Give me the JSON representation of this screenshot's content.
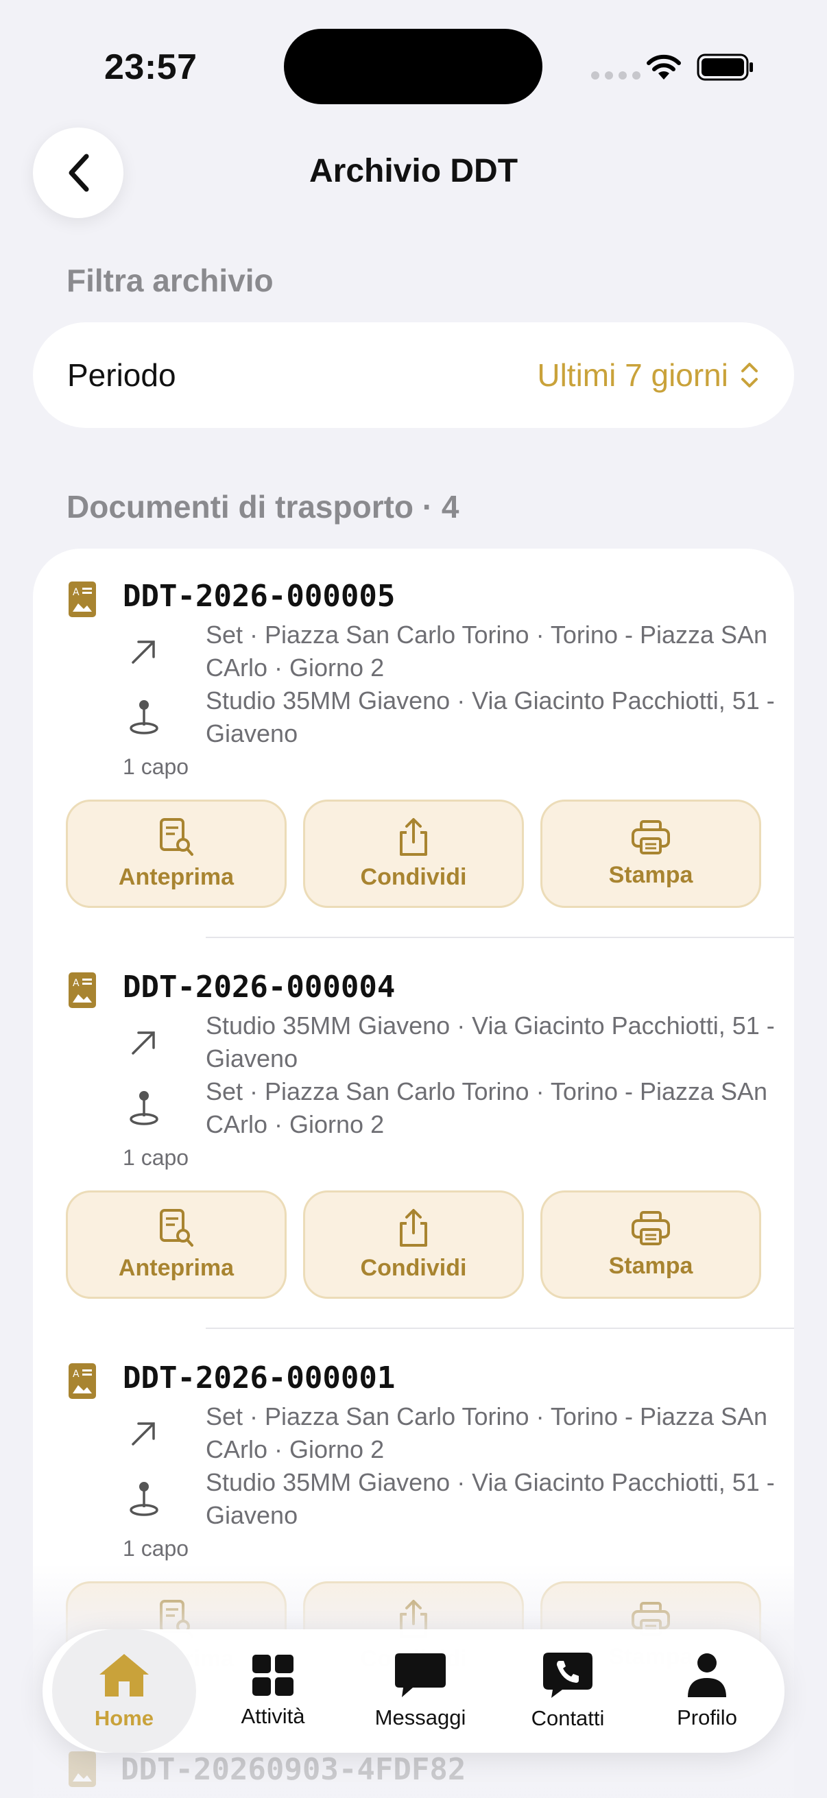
{
  "status_bar": {
    "time": "23:57"
  },
  "nav": {
    "title": "Archivio DDT"
  },
  "filter": {
    "section_title": "Filtra archivio",
    "period_label": "Periodo",
    "period_value": "Ultimi 7 giorni"
  },
  "documents": {
    "section_title": "Documenti di trasporto · 4",
    "items": [
      {
        "number": "DDT-2026-000005",
        "from": "Set · Piazza San Carlo Torino · Torino - Piazza SAn CArlo · Giorno 2",
        "to": "Studio 35MM Giaveno · Via Giacinto Pacchiotti, 51 - Giaveno",
        "count": "1 capo"
      },
      {
        "number": "DDT-2026-000004",
        "from": "Studio 35MM Giaveno · Via Giacinto Pacchiotti, 51 - Giaveno",
        "to": "Set · Piazza San Carlo Torino · Torino - Piazza SAn CArlo · Giorno 2",
        "count": "1 capo"
      },
      {
        "number": "DDT-2026-000001",
        "from": "Set · Piazza San Carlo Torino · Torino - Piazza SAn CArlo · Giorno 2",
        "to": "Studio 35MM Giaveno · Via Giacinto Pacchiotti, 51 - Giaveno",
        "count": "1 capo"
      },
      {
        "number": "DDT-20260903-4FDF82"
      }
    ],
    "actions": {
      "preview": "Anteprima",
      "share": "Condividi",
      "print": "Stampa"
    }
  },
  "tab_bar": {
    "home": "Home",
    "activities": "Attività",
    "messages": "Messaggi",
    "contacts": "Contatti",
    "profile": "Profilo"
  },
  "colors": {
    "accent": "#c9a23a",
    "button_bg": "#faf0e0",
    "background": "#f2f2f7"
  }
}
